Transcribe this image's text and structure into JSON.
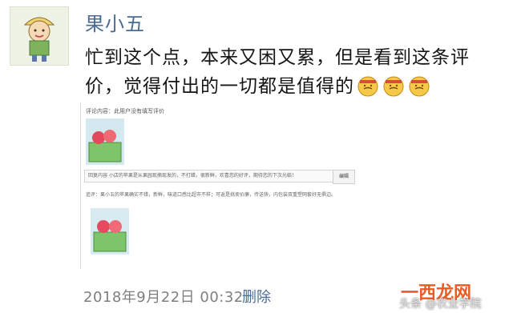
{
  "user": {
    "name": "果小五"
  },
  "post": {
    "text": "忙到这个点，本来又困又累，但是看到这条评价，觉得付出的一切都是值得的",
    "emoji_count": 3
  },
  "screenshot": {
    "header": "评论内容：此用户没有填写评价",
    "reply_text": "回复内容 小店的苹果是从果园现摘现发的，不打蜡，很新鲜，欢喜您的好评，期待您的下次光临！",
    "reply_button": "编辑",
    "followup_text": "追评：果小五的苹果确实不错，新鲜，味道口感比超市不样；可返是挑卖价廉，传送快，内包装双重塑网套好无俱边。"
  },
  "footer": {
    "timestamp": "2018年9月22日 00:32",
    "delete_label": "删除"
  },
  "watermark": {
    "logo": "一西龙网",
    "sub": "头条 @农业学院"
  }
}
